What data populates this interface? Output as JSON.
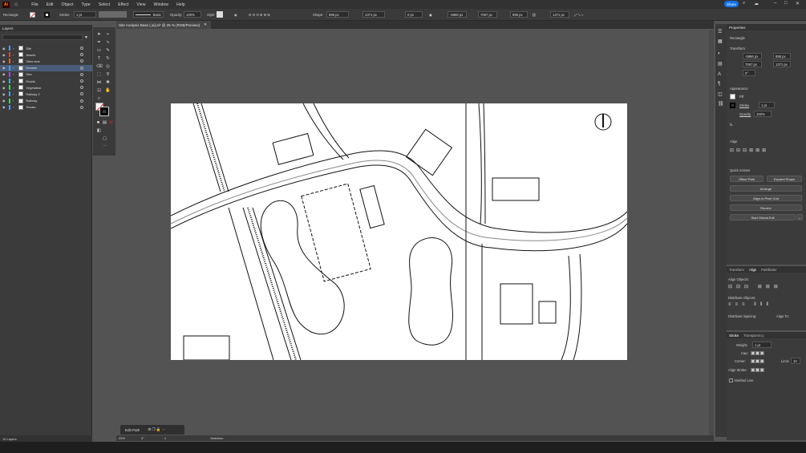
{
  "app": {
    "logo_text": "Ai",
    "menus": [
      "File",
      "Edit",
      "Object",
      "Type",
      "Select",
      "Effect",
      "View",
      "Window",
      "Help"
    ],
    "share_label": "Share"
  },
  "control_bar": {
    "selection_type": "Rectangle",
    "stroke_label": "Stroke:",
    "stroke_weight": "1 pt",
    "brush_label": "Basic",
    "opacity_label": "Opacity:",
    "opacity_value": "100%",
    "style_label": "Style:",
    "shape_label": "Shape:",
    "width_value": "898 px",
    "height_value": "1371 px",
    "rotate_value": "0 px",
    "x_value": "-5966 px",
    "y_value": "7067 px",
    "w_value": "898 px",
    "h_value": "1371 px"
  },
  "document_tab": {
    "title": "Site Analysis Base (.ai).ai* @ 25 % (RGB/Preview)"
  },
  "layers_panel": {
    "title": "Layers",
    "layers": [
      {
        "name": "Site",
        "color": "#4f9df7"
      },
      {
        "name": "Assets",
        "color": "#e8413f"
      },
      {
        "name": "Sites lane",
        "color": "#e36b1c"
      },
      {
        "name": "Houses",
        "color": "#4f9df7",
        "selected": true
      },
      {
        "name": "Sea",
        "color": "#a64ae8"
      },
      {
        "name": "Roads",
        "color": "#3bb5d6"
      },
      {
        "name": "Vegetation",
        "color": "#3ed65c"
      },
      {
        "name": "Railway 2",
        "color": "#4f9df7"
      },
      {
        "name": "Railway",
        "color": "#3ed65c"
      },
      {
        "name": "Terrain",
        "color": "#4f9df7"
      }
    ],
    "footer": "10 Layers"
  },
  "edit_bar": {
    "label": "Edit Path"
  },
  "status_bar": {
    "zoom": "25%",
    "angle": "0°",
    "page": "1",
    "tool": "Selection"
  },
  "properties": {
    "title": "Properties",
    "object_type": "Rectangle",
    "transform_label": "Transform",
    "x": "-5966 px",
    "y": "7067 px",
    "w": "898 px",
    "h": "1371 px",
    "angle": "0°",
    "appearance_label": "Appearance",
    "fill_label": "Fill",
    "stroke_label": "Stroke",
    "stroke_value": "1 pt",
    "opacity_label": "Opacity",
    "opacity_value": "100%",
    "fx_label": "fx.",
    "align_label": "Align",
    "quick_actions_label": "Quick Actions",
    "btn_offset_path": "Offset Path",
    "btn_expand_shape": "Expand Shape",
    "btn_arrange": "Arrange",
    "btn_align_pixel": "Align to Pixel Grid",
    "btn_recolor": "Recolor",
    "btn_start_global_edit": "Start Global Edit"
  },
  "align_panel": {
    "tabs": [
      "Transform",
      "Align",
      "Pathfinder"
    ],
    "align_objects": "Align Objects:",
    "distribute_objects": "Distribute Objects:",
    "distribute_spacing": "Distribute Spacing:",
    "align_to": "Align To:"
  },
  "stroke_panel": {
    "tabs": [
      "Stroke",
      "Transparency"
    ],
    "weight_label": "Weight:",
    "weight_value": "1 pt",
    "cap_label": "Cap:",
    "corner_label": "Corner:",
    "limit_label": "Limit:",
    "limit_value": "10",
    "align_stroke_label": "Align Stroke:",
    "dashed_line_label": "Dashed Line"
  }
}
